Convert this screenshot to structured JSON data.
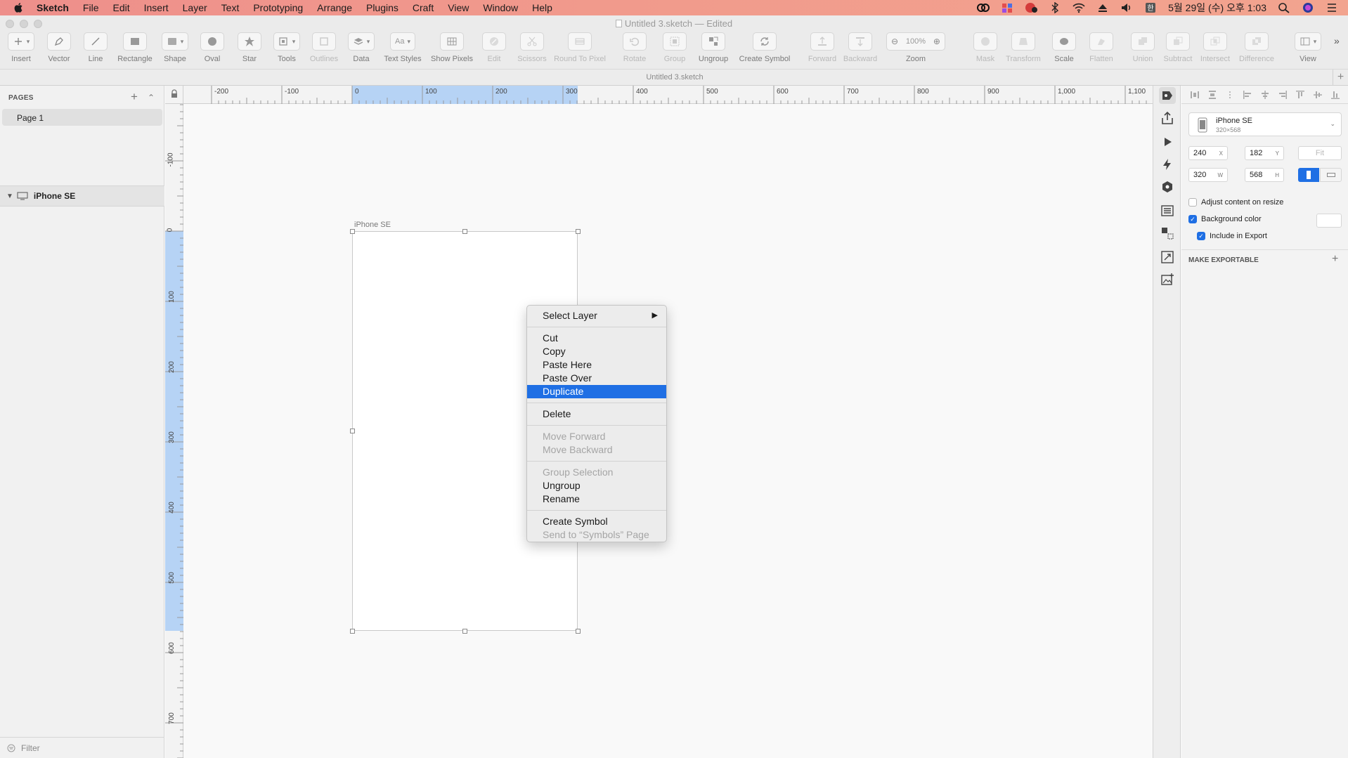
{
  "menubar": {
    "app": "Sketch",
    "items": [
      "File",
      "Edit",
      "Insert",
      "Layer",
      "Text",
      "Prototyping",
      "Arrange",
      "Plugins",
      "Craft",
      "View",
      "Window",
      "Help"
    ],
    "clock": "5월 29일 (수) 오후 1:03"
  },
  "window": {
    "title": "Untitled 3.sketch — Edited",
    "tab": "Untitled 3.sketch"
  },
  "toolbar": {
    "insert": "Insert",
    "vector": "Vector",
    "line": "Line",
    "rectangle": "Rectangle",
    "shape": "Shape",
    "oval": "Oval",
    "star": "Star",
    "tools": "Tools",
    "outlines": "Outlines",
    "data": "Data",
    "text_styles": "Text Styles",
    "text_styles_btn": "Aa",
    "show_pixels": "Show Pixels",
    "edit": "Edit",
    "scissors": "Scissors",
    "round_to_pixel": "Round To Pixel",
    "rotate": "Rotate",
    "group": "Group",
    "ungroup": "Ungroup",
    "create_symbol": "Create Symbol",
    "forward": "Forward",
    "backward": "Backward",
    "zoom": "Zoom",
    "zoom_value": "100%",
    "mask": "Mask",
    "transform": "Transform",
    "scale": "Scale",
    "flatten": "Flatten",
    "union": "Union",
    "subtract": "Subtract",
    "intersect": "Intersect",
    "difference": "Difference",
    "view": "View"
  },
  "left_panel": {
    "pages_header": "PAGES",
    "pages": [
      "Page 1"
    ],
    "layers": [
      "iPhone SE"
    ],
    "filter_placeholder": "Filter"
  },
  "rulers": {
    "horizontal": [
      "-200",
      "-100",
      "0",
      "100",
      "200",
      "300",
      "400",
      "500",
      "600",
      "700",
      "800",
      "900",
      "1,000",
      "1,100"
    ],
    "vertical": [
      "-100",
      "0",
      "100",
      "200",
      "300",
      "400",
      "500",
      "600",
      "700"
    ]
  },
  "artboard": {
    "label": "iPhone SE"
  },
  "context_menu": {
    "items": [
      {
        "label": "Select Layer",
        "submenu": true
      },
      {
        "label": "Cut"
      },
      {
        "label": "Copy"
      },
      {
        "label": "Paste Here"
      },
      {
        "label": "Paste Over"
      },
      {
        "label": "Duplicate",
        "highlighted": true
      },
      {
        "label": "Delete"
      },
      {
        "label": "Move Forward",
        "disabled": true
      },
      {
        "label": "Move Backward",
        "disabled": true
      },
      {
        "label": "Group Selection",
        "disabled": true
      },
      {
        "label": "Ungroup"
      },
      {
        "label": "Rename"
      },
      {
        "label": "Create Symbol"
      },
      {
        "label": "Send to “Symbols” Page",
        "disabled": true
      }
    ]
  },
  "inspector": {
    "preset_name": "iPhone SE",
    "preset_size": "320×568",
    "x": "240",
    "x_label": "X",
    "y": "182",
    "y_label": "Y",
    "w": "320",
    "w_label": "W",
    "h": "568",
    "h_label": "H",
    "fit": "Fit",
    "adjust_content": "Adjust content on resize",
    "background_color": "Background color",
    "include_in_export": "Include in Export",
    "make_exportable": "MAKE EXPORTABLE"
  },
  "colors": {
    "accent": "#1f6fe4",
    "ruler_selection": "#b6d3f5"
  }
}
